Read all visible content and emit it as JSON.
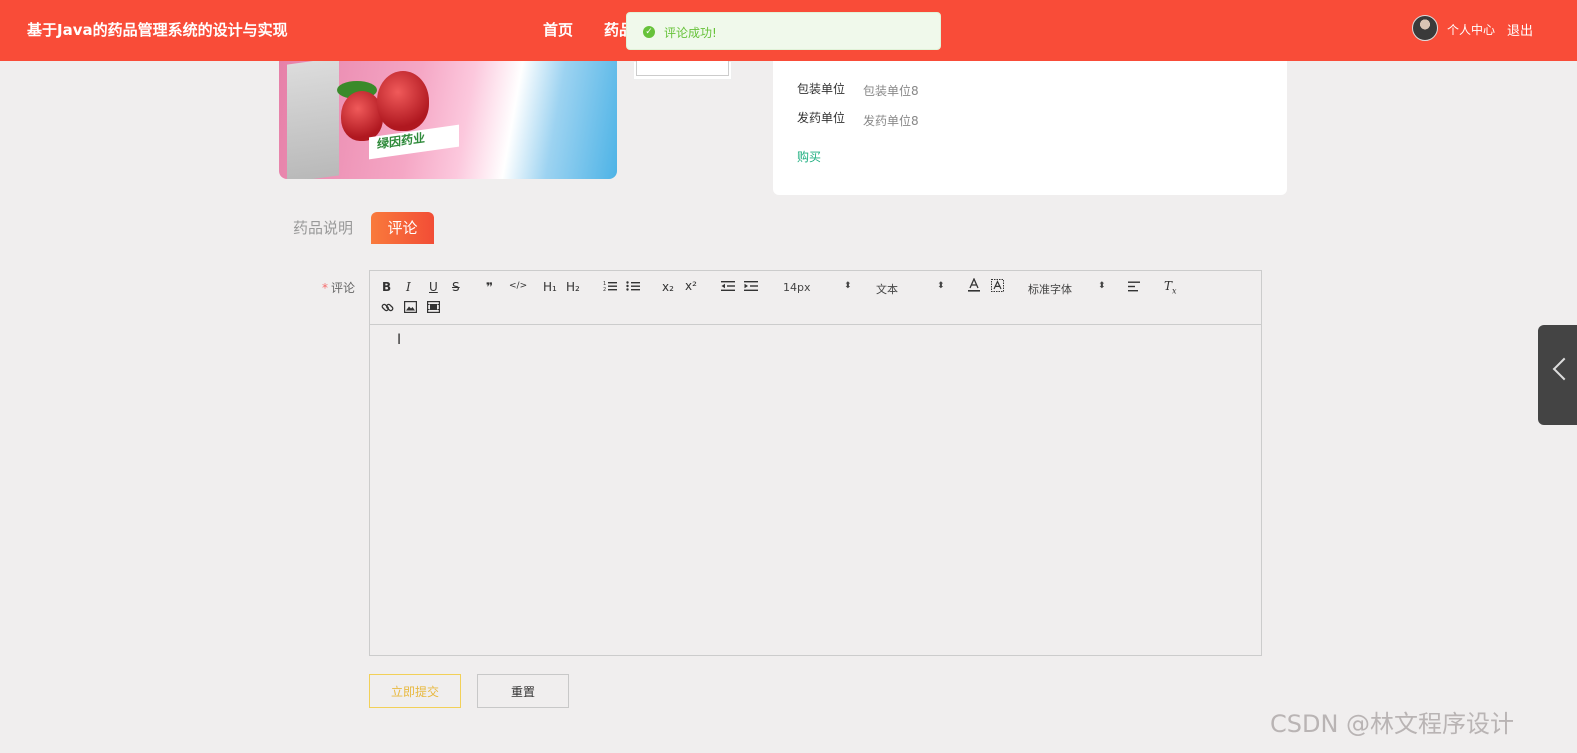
{
  "header": {
    "site_title": "基于Java的药品管理系统的设计与实现",
    "nav": {
      "home": "首页",
      "medicine": "药品"
    },
    "user_center": "个人中心",
    "logout": "退出"
  },
  "toast": {
    "message": "评论成功!",
    "type": "success"
  },
  "product": {
    "brand_text": "绿因药业",
    "info": [
      {
        "label": "包装单位",
        "value": "包装单位8"
      },
      {
        "label": "发药单位",
        "value": "发药单位8"
      }
    ],
    "buy_label": "购买"
  },
  "tabs": [
    {
      "label": "药品说明",
      "active": false
    },
    {
      "label": "评论",
      "active": true
    }
  ],
  "comment_form": {
    "required_mark": "*",
    "label": "评论",
    "toolbar": {
      "buttons": [
        "B",
        "I",
        "U",
        "S",
        "❞",
        "</>",
        "H₁",
        "H₂",
        "ordered-list",
        "bullet-list",
        "x₂",
        "x²",
        "outdent",
        "indent"
      ],
      "font_size": "14px",
      "header_select": "文本",
      "font_family": "标准字体",
      "icons": [
        "text-color-icon",
        "background-color-icon",
        "align-icon",
        "clear-format-icon",
        "link-icon",
        "image-icon",
        "video-icon"
      ]
    },
    "editor_value": "",
    "submit_label": "立即提交",
    "reset_label": "重置"
  },
  "watermark": "CSDN @林文程序设计",
  "colors": {
    "header_bg": "#f94c38",
    "accent_tab": "#f24d36",
    "success": "#67c23a",
    "buy_link": "#1dae7f"
  }
}
